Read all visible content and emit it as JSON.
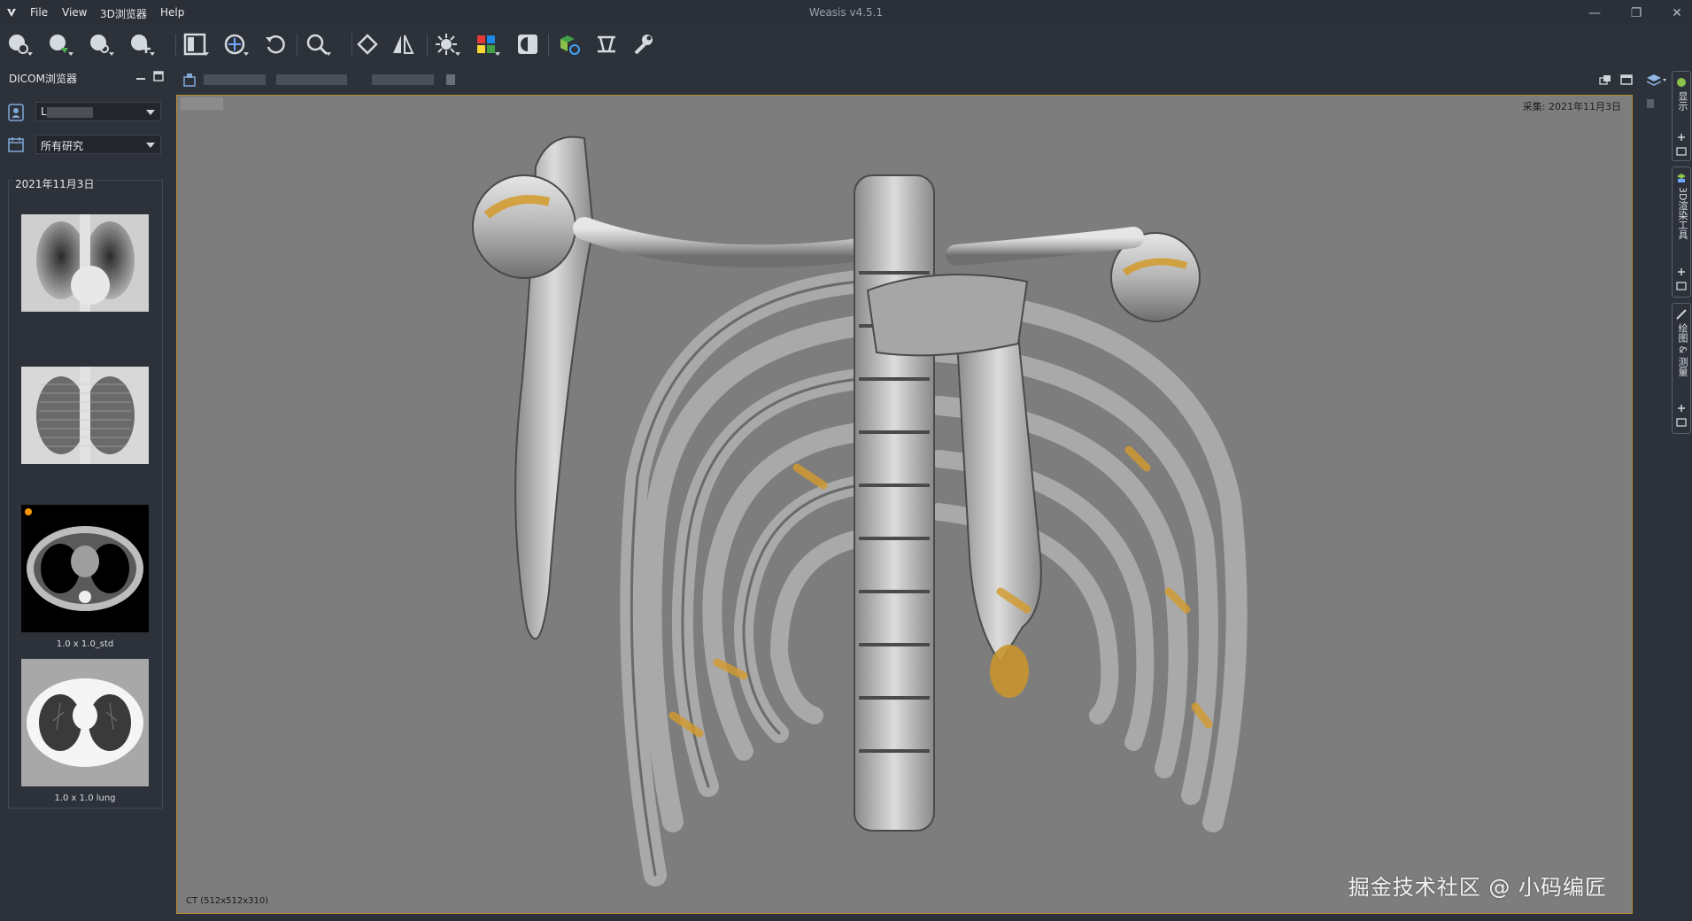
{
  "menu": [
    "File",
    "View",
    "3D浏览器",
    "Help"
  ],
  "window": {
    "title": "Weasis v4.5.1",
    "controls": [
      "—",
      "❐",
      "✕"
    ]
  },
  "toolbar": {
    "tools": [
      "import-dicom",
      "export-dicom",
      "search-dicom",
      "add-dicom",
      "layout",
      "sync-views",
      "undo",
      "zoom",
      "rotate",
      "flip",
      "window-level",
      "color-lut",
      "invert",
      "volume-3d",
      "crop-box",
      "settings"
    ]
  },
  "left_panel": {
    "title": "DICOM浏览器",
    "patient_value": "L",
    "study_filter": "所有研究",
    "study_date": "2021年11月3日",
    "thumbnails": [
      {
        "label": "",
        "kind": "chest-xray"
      },
      {
        "label": "",
        "kind": "chest-xray-scout"
      },
      {
        "label": "1.0 x 1.0_std",
        "kind": "ct-mediastinum"
      },
      {
        "label": "1.0 x 1.0  lung",
        "kind": "ct-lung"
      }
    ]
  },
  "viewer": {
    "acquisition_label": "采集: 2021年11月3日",
    "series_info": "CT (512x512x310)",
    "watermark": "掘金技术社区 @ 小码编匠"
  },
  "right_dock": {
    "tabs": [
      "显示",
      "3D渲染工具",
      "绘图 & 测量"
    ]
  },
  "colors": {
    "accent": "#b8892f",
    "panel": "#2d313a",
    "viewport_bg": "#7d7d7d"
  }
}
